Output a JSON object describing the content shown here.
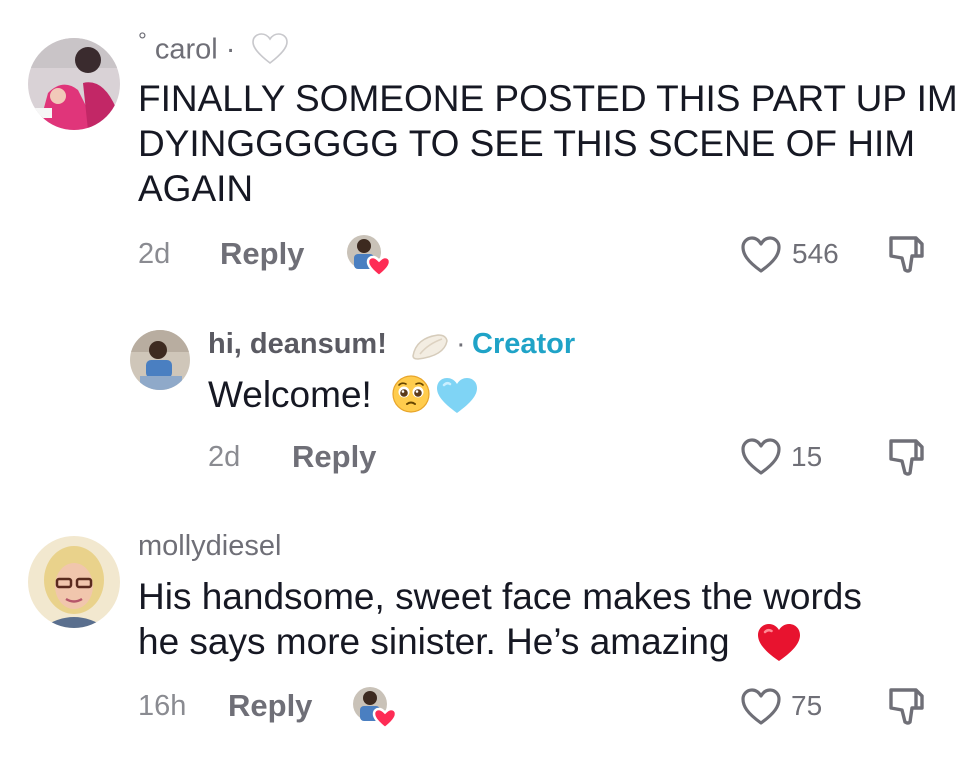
{
  "comments": [
    {
      "username_prefix": "°",
      "username": "carol",
      "separator": "·",
      "badge_icon": "white-heart-emoji",
      "text_lines": [
        "FINALLY SOMEONE POSTED THIS PART UP IM",
        "DYINGGGGGG TO SEE THIS SCENE OF HIM",
        "AGAIN"
      ],
      "time": "2d",
      "reply_label": "Reply",
      "likes": "546",
      "creator_liked": true
    },
    {
      "username": "hi, deansum!",
      "badge_icon": "dumpling-emoji",
      "separator": "·",
      "creator_label": "Creator",
      "text": "Welcome!",
      "emojis": [
        "pleading-face-emoji",
        "light-blue-heart-emoji"
      ],
      "time": "2d",
      "reply_label": "Reply",
      "likes": "15"
    },
    {
      "username": "mollydiesel",
      "text_lines": [
        "His handsome, sweet face makes the words",
        "he says more sinister. He’s amazing"
      ],
      "emojis": [
        "red-heart-emoji"
      ],
      "time": "16h",
      "reply_label": "Reply",
      "likes": "75",
      "creator_liked": true
    }
  ],
  "colors": {
    "text": "#161823",
    "username": "#6f6f77",
    "meta": "#8a8b91",
    "creator": "#1fa3c7",
    "heart": "#fe2c55"
  }
}
